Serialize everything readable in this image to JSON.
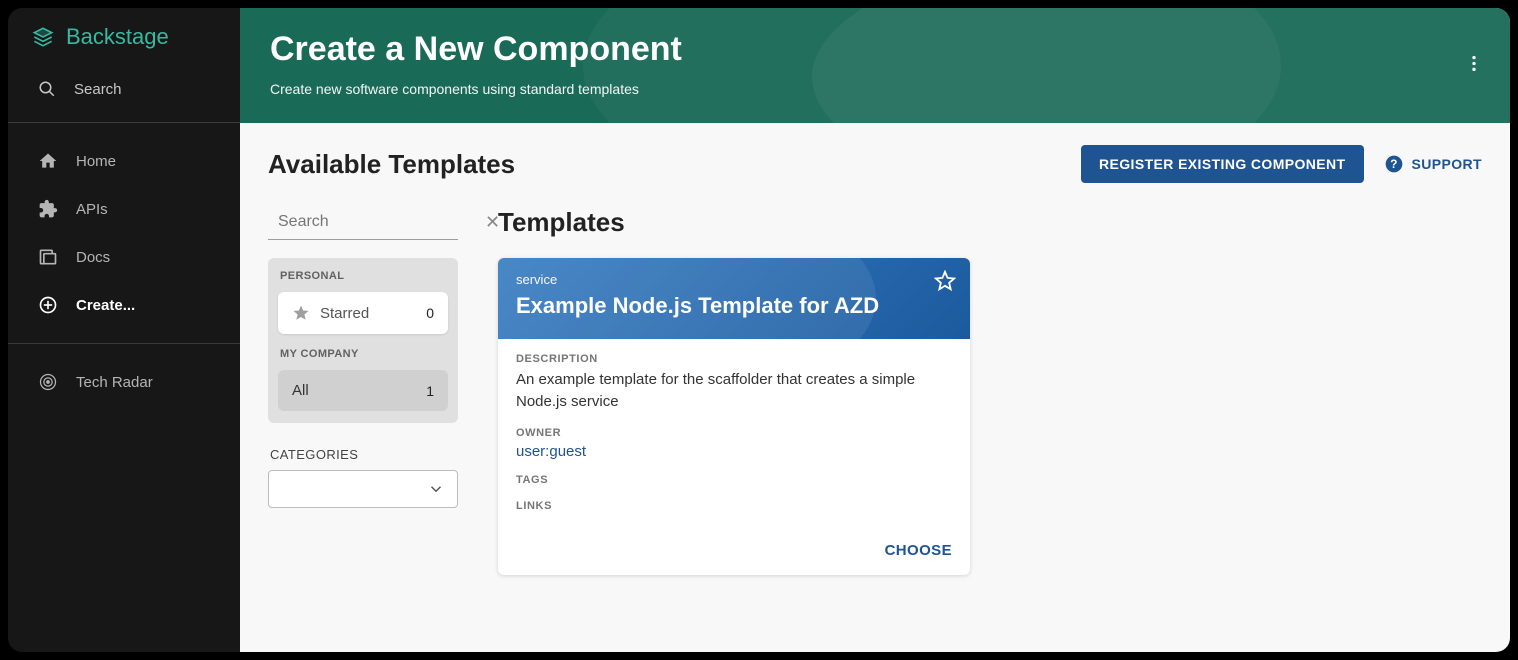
{
  "brand": {
    "name": "Backstage"
  },
  "sidebar": {
    "search_label": "Search",
    "items": [
      {
        "label": "Home",
        "icon": "home"
      },
      {
        "label": "APIs",
        "icon": "extension"
      },
      {
        "label": "Docs",
        "icon": "library"
      },
      {
        "label": "Create...",
        "icon": "add-circle",
        "active": true
      }
    ],
    "group2": [
      {
        "label": "Tech Radar",
        "icon": "target"
      }
    ]
  },
  "hero": {
    "title": "Create a New Component",
    "subtitle": "Create new software components using standard templates"
  },
  "content": {
    "heading": "Available Templates",
    "register_button": "REGISTER EXISTING COMPONENT",
    "support": "SUPPORT"
  },
  "filter": {
    "search_placeholder": "Search",
    "personal_label": "PERSONAL",
    "starred_label": "Starred",
    "starred_count": "0",
    "company_label": "MY COMPANY",
    "all_label": "All",
    "all_count": "1",
    "categories_label": "CATEGORIES"
  },
  "templates": {
    "heading": "Templates",
    "card": {
      "type": "service",
      "title": "Example Node.js Template for AZD",
      "description_label": "DESCRIPTION",
      "description": "An example template for the scaffolder that creates a simple Node.js service",
      "owner_label": "OWNER",
      "owner": "user:guest",
      "tags_label": "TAGS",
      "links_label": "LINKS",
      "choose": "CHOOSE"
    }
  }
}
